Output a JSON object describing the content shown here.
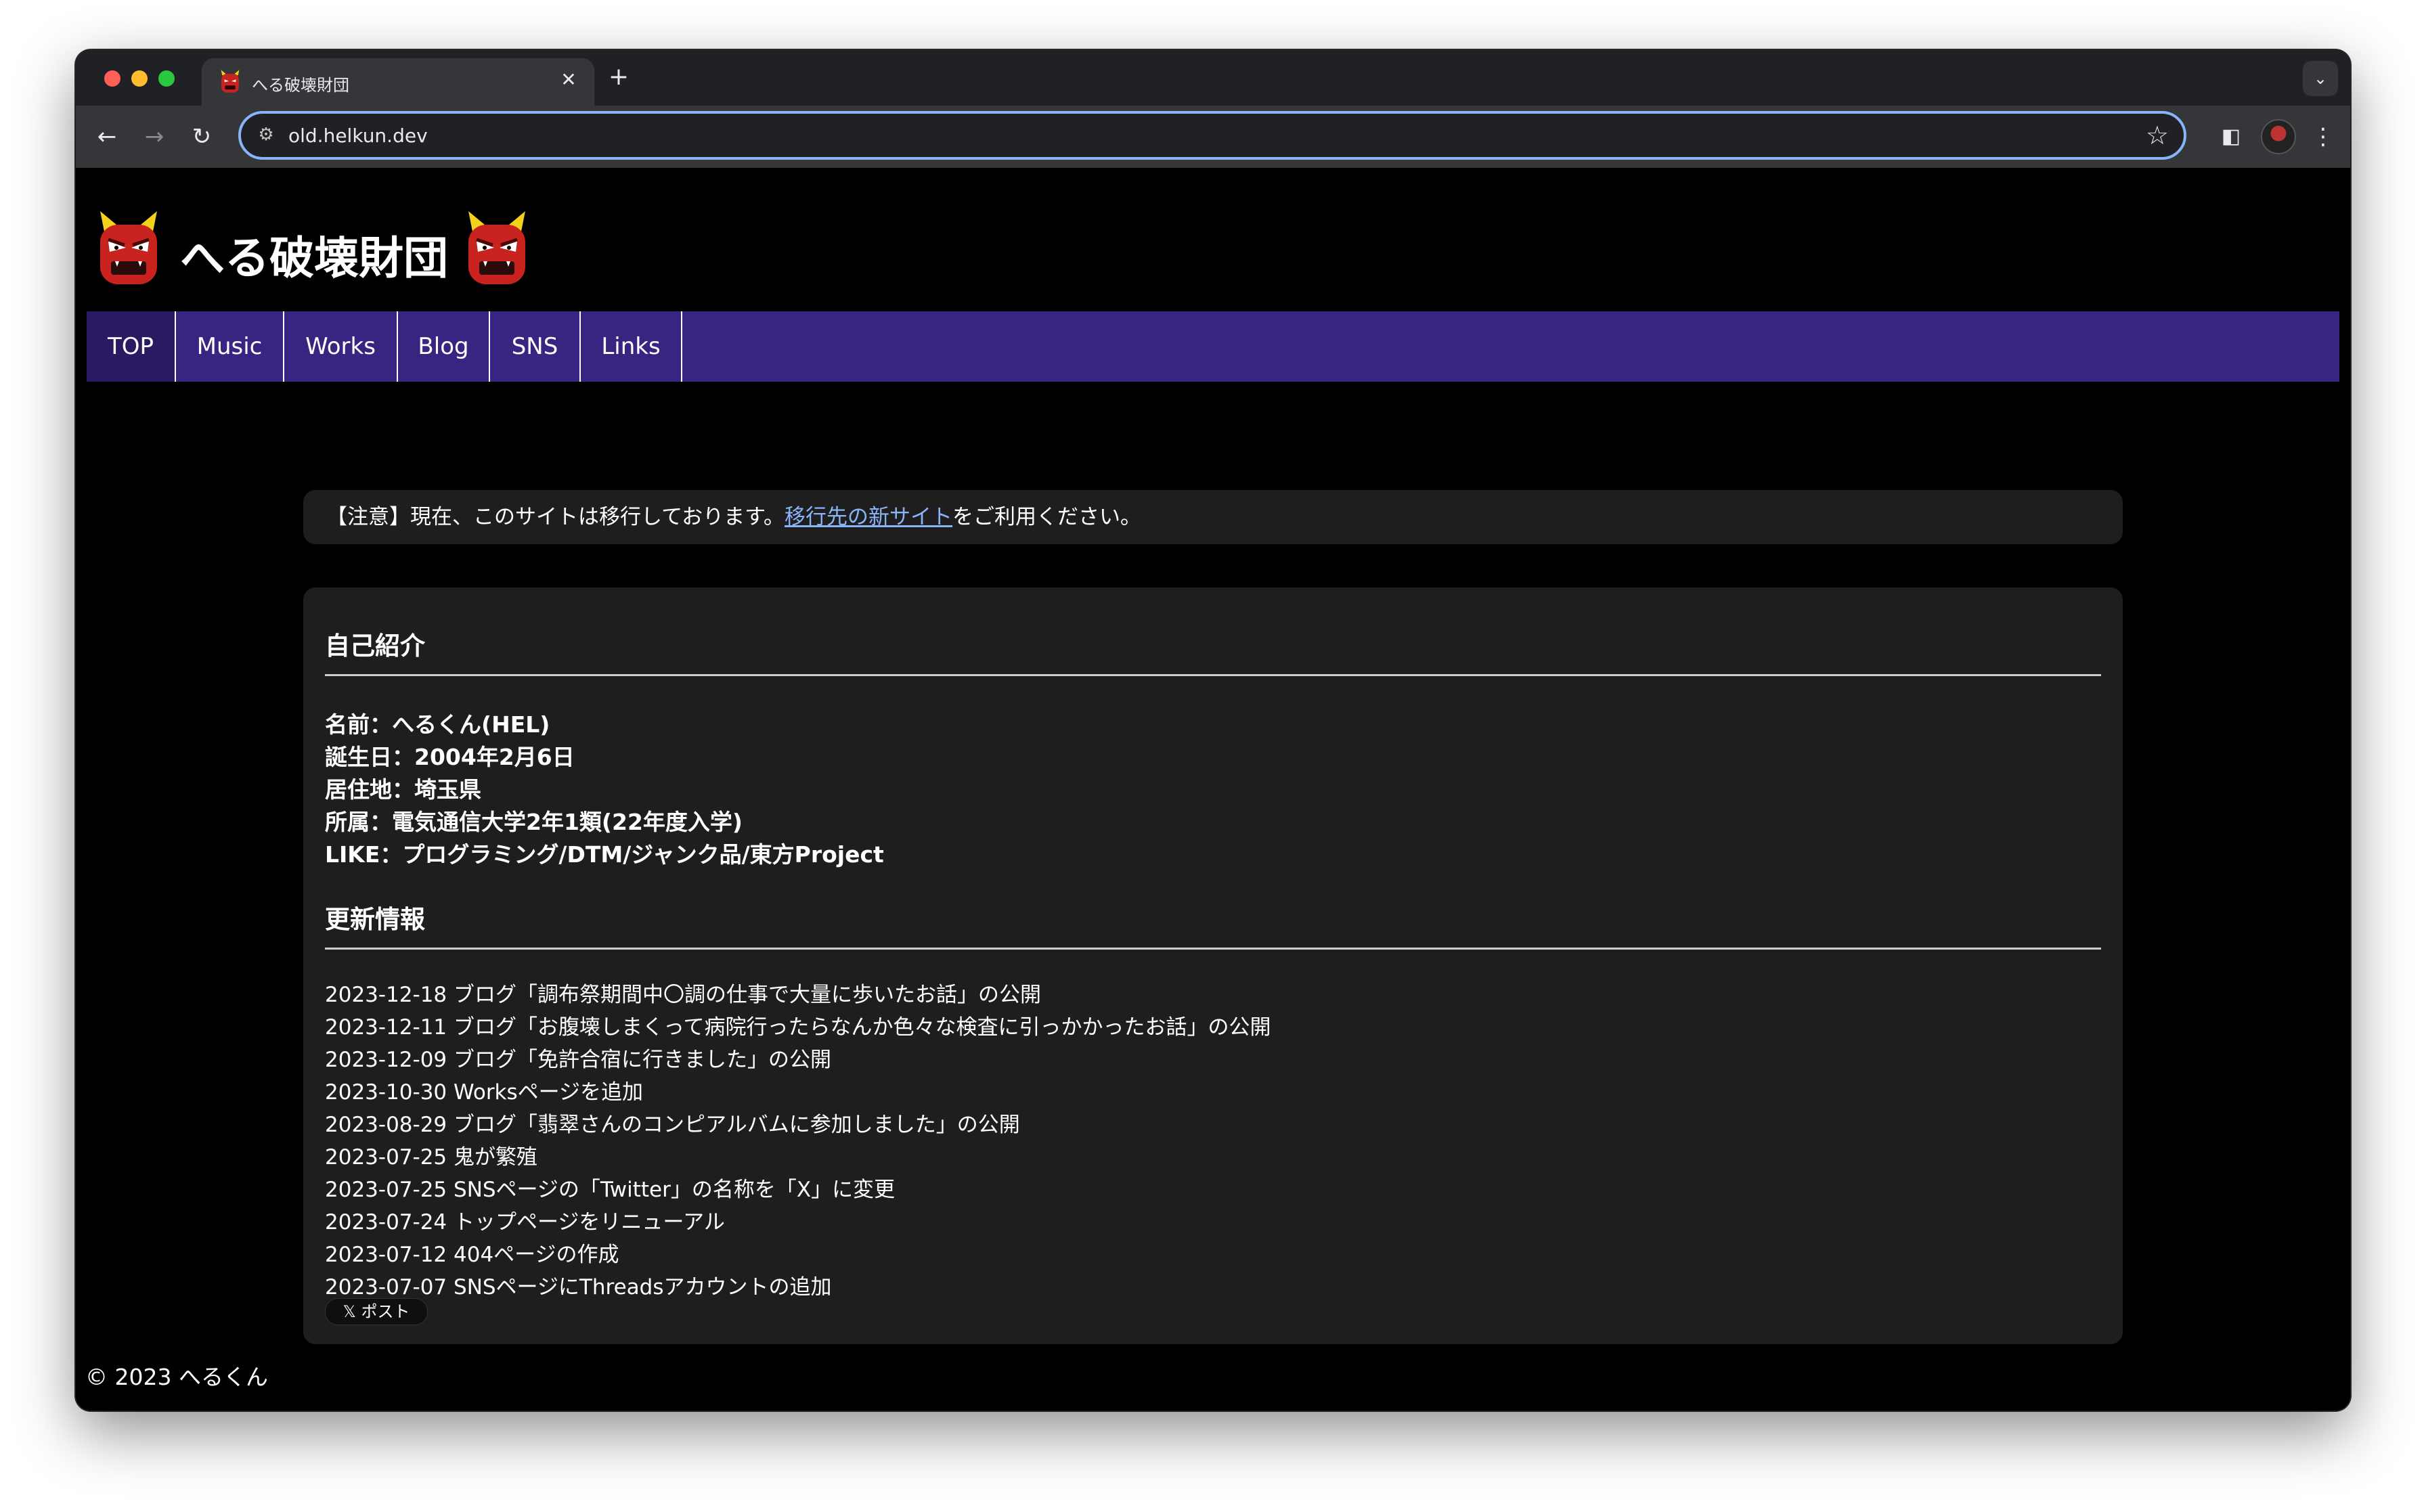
{
  "browser": {
    "tab_title": "へる破壊財団",
    "tab_close": "✕",
    "new_tab": "+",
    "tab_list": "⌄",
    "url": "old.helkun.dev",
    "back": "←",
    "forward": "→",
    "reload": "↻",
    "star": "☆",
    "side_panel": "◧",
    "menu": "⋮",
    "site_info": "⚙"
  },
  "site": {
    "title": "へる破壊財団",
    "nav": [
      "TOP",
      "Music",
      "Works",
      "Blog",
      "SNS",
      "Links"
    ],
    "notice": {
      "prefix": "【注意】現在、このサイトは移行しております。",
      "link": "移行先の新サイト",
      "suffix": "をご利用ください。"
    },
    "profile": {
      "heading": "自己紹介",
      "lines": [
        "名前：へるくん(HEL)",
        "誕生日：2004年2月6日",
        "居住地：埼玉県",
        "所属：電気通信大学2年1類(22年度入学)",
        "LIKE：プログラミング/DTM/ジャンク品/東方Project"
      ]
    },
    "updates": {
      "heading": "更新情報",
      "items": [
        "2023-12-18 ブログ「調布祭期間中〇調の仕事で大量に歩いたお話」の公開",
        "2023-12-11 ブログ「お腹壊しまくって病院行ったらなんか色々な検査に引っかかったお話」の公開",
        "2023-12-09 ブログ「免許合宿に行きました」の公開",
        "2023-10-30 Worksページを追加",
        "2023-08-29 ブログ「翡翠さんのコンピアルバムに参加しました」の公開",
        "2023-07-25 鬼が繁殖",
        "2023-07-25 SNSページの「Twitter」の名称を「X」に変更",
        "2023-07-24 トップページをリニューアル",
        "2023-07-12 404ページの作成",
        "2023-07-07 SNSページにThreadsアカウントの追加"
      ]
    },
    "x_post_button": "𝕏 ポスト",
    "footer": "© 2023 へるくん"
  },
  "colors": {
    "nav_background": "#392482",
    "nav_active": "#2a1a63",
    "card_background": "#1e1e1e",
    "link": "#8ab4f8",
    "page_background": "#000000"
  },
  "icons": {
    "favicon": "oni-demon-icon",
    "header_left": "oni-demon-icon",
    "header_right": "oni-demon-icon"
  }
}
